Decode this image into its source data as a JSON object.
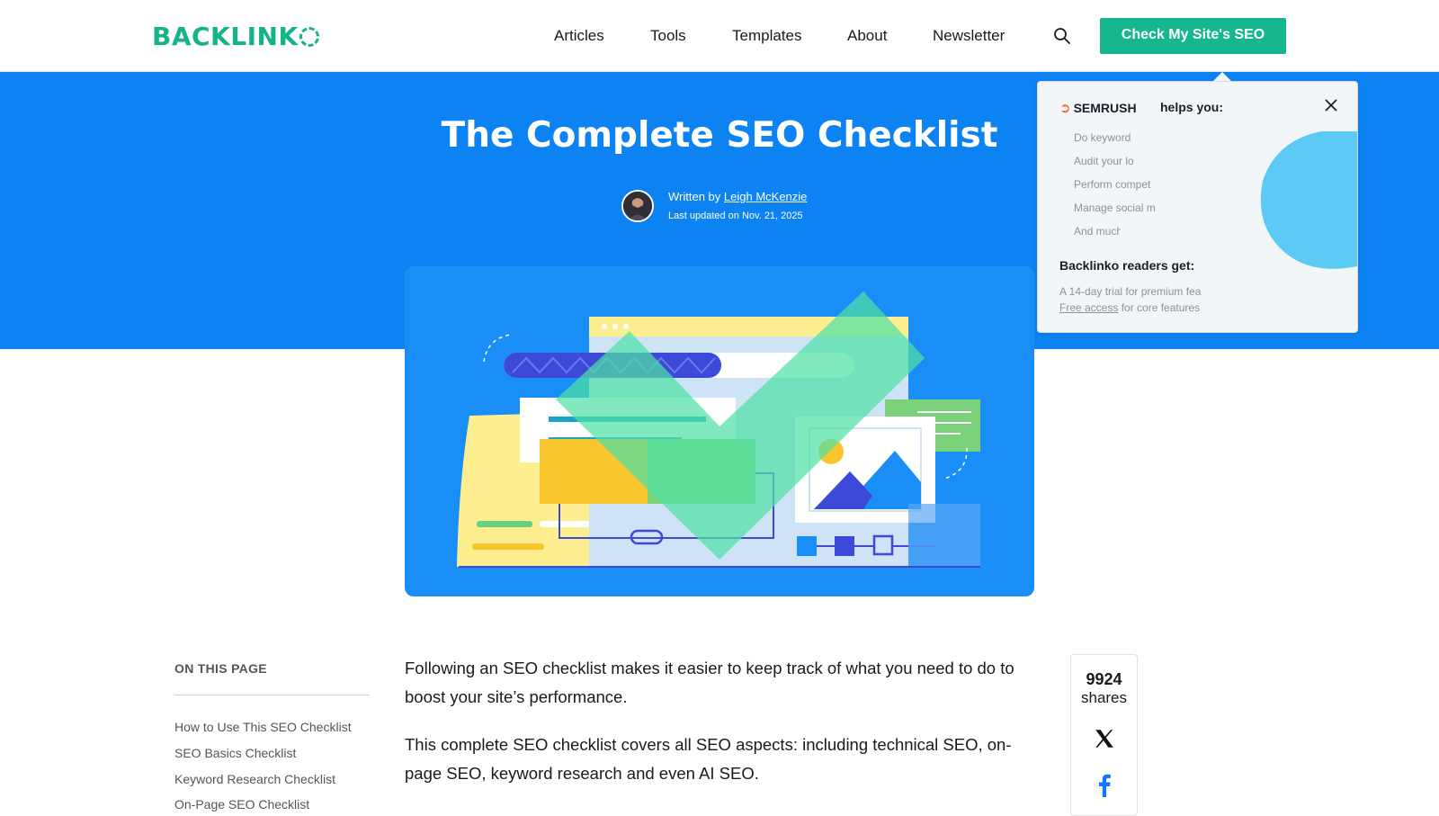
{
  "header": {
    "logo_text": "BACKLINK",
    "nav": [
      "Articles",
      "Tools",
      "Templates",
      "About",
      "Newsletter"
    ],
    "cta_label": "Check My Site's SEO"
  },
  "hero": {
    "title": "The Complete SEO Checklist",
    "written_by_prefix": "Written by",
    "author_name": "Leigh McKenzie",
    "last_updated": "Last updated on Nov. 21, 2025"
  },
  "popup": {
    "brand": "SEMRUSH",
    "helps_you": "helps you:",
    "helps_list": [
      "Do keyword",
      "Audit your lo",
      "Perform compet",
      "Manage social m",
      "And much"
    ],
    "readers_title": "Backlinko readers get:",
    "readers_line1": "A 14-day trial for premium fea",
    "readers_link": "Free access",
    "readers_line2_rest": "for core features"
  },
  "toc": {
    "title": "ON THIS PAGE",
    "items": [
      "How to Use This SEO Checklist",
      "SEO Basics Checklist",
      "Keyword Research Checklist",
      "On-Page SEO Checklist"
    ]
  },
  "article": {
    "paragraphs": [
      "Following an SEO checklist makes it easier to keep track of what you need to do to boost your site’s performance.",
      "This complete SEO checklist covers all SEO aspects: including technical SEO, on-page SEO, keyword research and even AI SEO."
    ]
  },
  "shares": {
    "count": "9924",
    "label": "shares"
  },
  "colors": {
    "brand_green": "#14b38a",
    "hero_blue": "#0d83f3",
    "semrush_orange": "#ff642d"
  },
  "icons": [
    "search-icon",
    "close-icon",
    "x-icon",
    "facebook-icon",
    "semrush-flame-icon"
  ]
}
